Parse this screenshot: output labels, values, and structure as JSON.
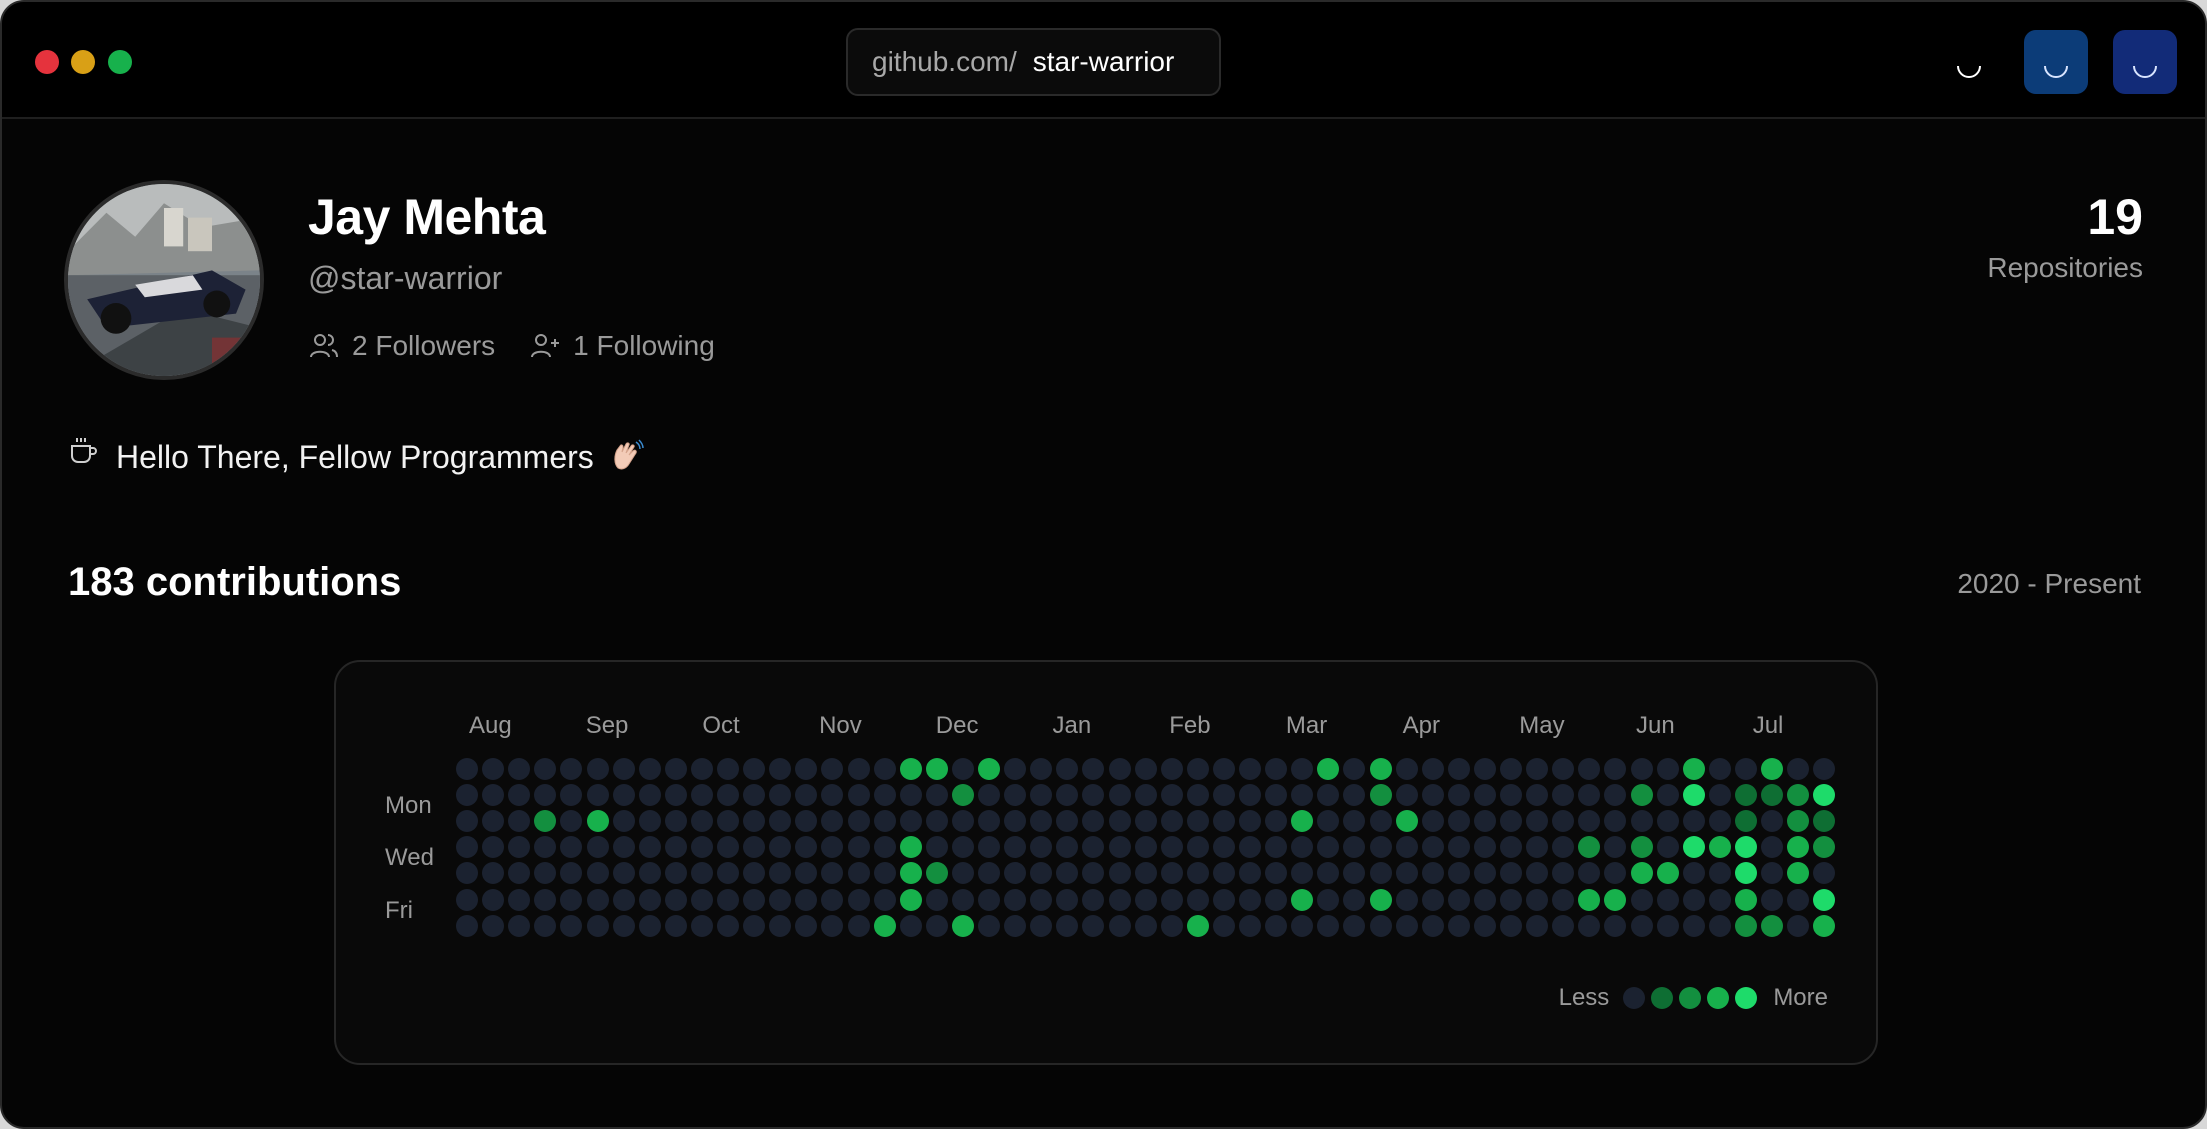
{
  "titlebar": {
    "url_prefix": "github.com/",
    "url_user": "star-warrior"
  },
  "profile": {
    "name": "Jay Mehta",
    "handle": "@star-warrior",
    "followers": "2 Followers",
    "following": "1 Following",
    "repo_count": "19",
    "repo_label": "Repositories",
    "bio": "Hello There, Fellow Programmers"
  },
  "contributions": {
    "title": "183 contributions",
    "range": "2020 - Present",
    "months": [
      "Aug",
      "Sep",
      "Oct",
      "Nov",
      "Dec",
      "Jan",
      "Feb",
      "Mar",
      "Apr",
      "May",
      "Jun",
      "Jul"
    ],
    "day_labels": [
      "Mon",
      "Wed",
      "Fri"
    ],
    "legend_less": "Less",
    "legend_more": "More",
    "level_colors": [
      "#1b2230",
      "#0e6e33",
      "#138f3f",
      "#17b14c",
      "#1edb6a"
    ],
    "weeks": 53,
    "active_cells": [
      [
        0,
        17,
        3
      ],
      [
        0,
        18,
        3
      ],
      [
        0,
        20,
        3
      ],
      [
        0,
        33,
        3
      ],
      [
        0,
        35,
        3
      ],
      [
        0,
        47,
        3
      ],
      [
        0,
        50,
        3
      ],
      [
        1,
        19,
        2
      ],
      [
        1,
        35,
        2
      ],
      [
        1,
        45,
        2
      ],
      [
        1,
        47,
        4
      ],
      [
        1,
        49,
        1
      ],
      [
        1,
        50,
        1
      ],
      [
        1,
        51,
        2
      ],
      [
        1,
        52,
        4
      ],
      [
        2,
        3,
        2
      ],
      [
        2,
        5,
        3
      ],
      [
        2,
        32,
        3
      ],
      [
        2,
        36,
        3
      ],
      [
        2,
        49,
        1
      ],
      [
        2,
        51,
        2
      ],
      [
        2,
        52,
        1
      ],
      [
        3,
        17,
        3
      ],
      [
        3,
        43,
        2
      ],
      [
        3,
        45,
        2
      ],
      [
        3,
        47,
        4
      ],
      [
        3,
        48,
        3
      ],
      [
        3,
        49,
        4
      ],
      [
        3,
        51,
        3
      ],
      [
        3,
        52,
        2
      ],
      [
        4,
        17,
        3
      ],
      [
        4,
        18,
        2
      ],
      [
        4,
        45,
        3
      ],
      [
        4,
        46,
        3
      ],
      [
        4,
        49,
        5
      ],
      [
        4,
        51,
        3
      ],
      [
        5,
        17,
        3
      ],
      [
        5,
        32,
        3
      ],
      [
        5,
        35,
        3
      ],
      [
        5,
        43,
        3
      ],
      [
        5,
        44,
        3
      ],
      [
        5,
        49,
        3
      ],
      [
        5,
        52,
        4
      ],
      [
        6,
        16,
        3
      ],
      [
        6,
        19,
        3
      ],
      [
        6,
        28,
        3
      ],
      [
        6,
        49,
        2
      ],
      [
        6,
        50,
        2
      ],
      [
        6,
        52,
        3
      ]
    ]
  }
}
